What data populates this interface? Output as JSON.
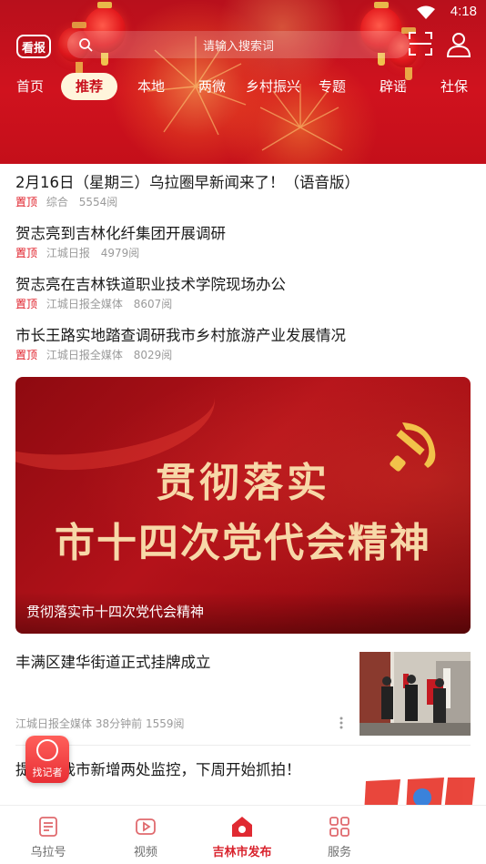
{
  "status_bar": {
    "time": "4:18"
  },
  "header": {
    "logo_text": "看报",
    "search_placeholder": "请输入搜索词",
    "tabs": [
      {
        "label": "首页"
      },
      {
        "label": "推荐",
        "active": true
      },
      {
        "label": "本地"
      },
      {
        "label": "两微"
      },
      {
        "label": "乡村振兴"
      },
      {
        "label": "专题"
      },
      {
        "label": "辟谣"
      },
      {
        "label": "社保"
      }
    ]
  },
  "top_news": [
    {
      "title": "2月16日（星期三）乌拉圈早新闻来了！（语音版）",
      "tag": "置顶",
      "source": "综合",
      "reads": "5554阅"
    },
    {
      "title": "贺志亮到吉林化纤集团开展调研",
      "tag": "置顶",
      "source": "江城日报",
      "reads": "4979阅"
    },
    {
      "title": "贺志亮在吉林铁道职业技术学院现场办公",
      "tag": "置顶",
      "source": "江城日报全媒体",
      "reads": "8607阅"
    },
    {
      "title": "市长王路实地踏查调研我市乡村旅游产业发展情况",
      "tag": "置顶",
      "source": "江城日报全媒体",
      "reads": "8029阅"
    }
  ],
  "banner": {
    "line1": "贯彻落实",
    "line2": "市十四次党代会精神",
    "caption": "贯彻落实市十四次党代会精神"
  },
  "article": {
    "title": "丰满区建华街道正式挂牌成立",
    "source": "江城日报全媒体",
    "time": "38分钟前",
    "reads": "1559阅"
  },
  "partial_article": {
    "title": "提醒！我市新增两处监控，下周开始抓拍！"
  },
  "floating": {
    "reporter_label": "找记者"
  },
  "bottom_nav": [
    {
      "label": "乌拉号",
      "icon": "document-icon"
    },
    {
      "label": "视频",
      "icon": "video-icon"
    },
    {
      "label": "吉林市发布",
      "icon": "home-icon",
      "active": true
    },
    {
      "label": "服务",
      "icon": "grid-icon"
    }
  ],
  "colors": {
    "brand_red": "#d0121e",
    "pin_red": "#e0212b",
    "active_tab_bg": "#fff5dc"
  }
}
